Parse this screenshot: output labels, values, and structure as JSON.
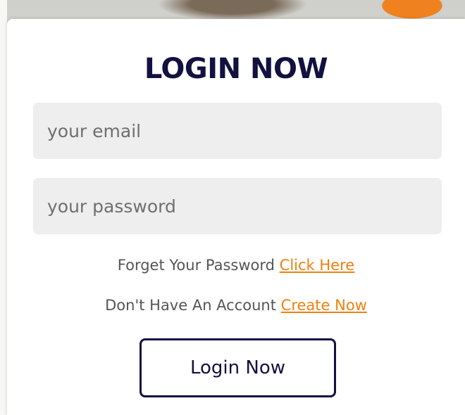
{
  "login": {
    "title": "LOGIN NOW",
    "email_placeholder": "your email",
    "password_placeholder": "your password",
    "forgot_text": "Forget Your Password",
    "forgot_link": "Click Here",
    "signup_text": "Don't Have An Account",
    "signup_link": "Create Now",
    "submit_label": "Login Now"
  },
  "colors": {
    "title": "#13113f",
    "link": "#f27f0c",
    "field_bg": "#eeeeee",
    "button_border": "#13113f"
  }
}
